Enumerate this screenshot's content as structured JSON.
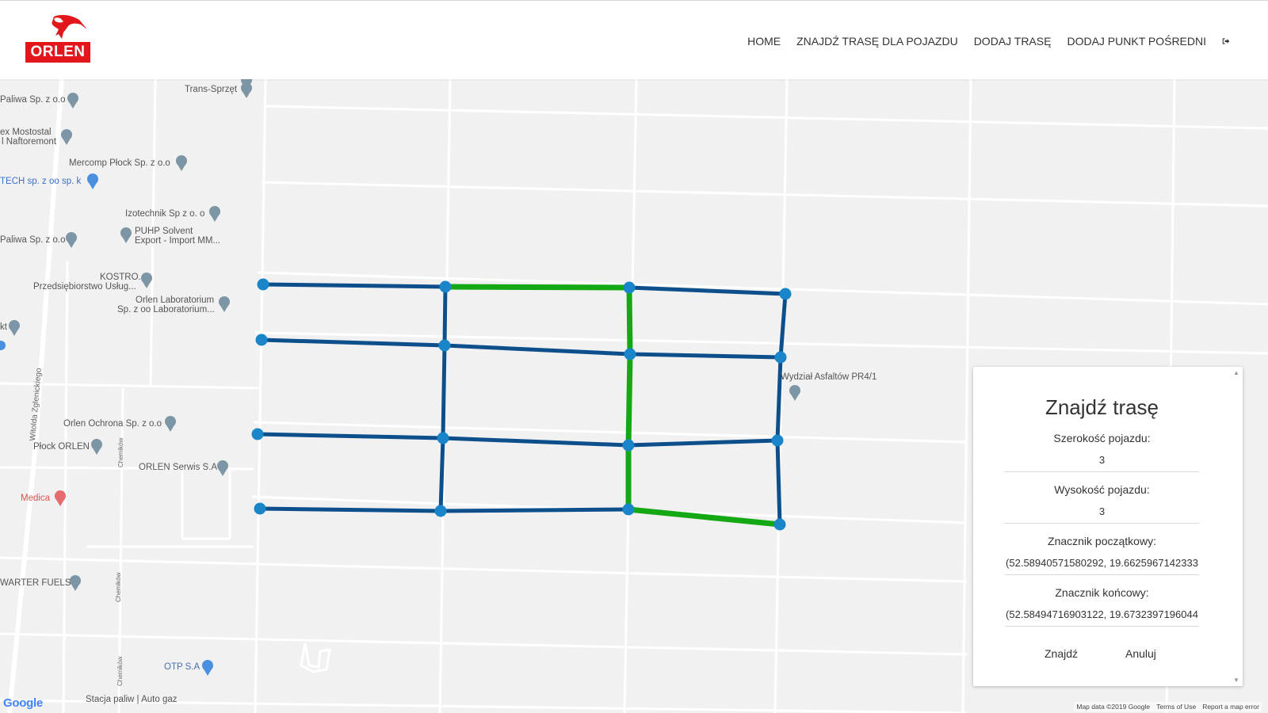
{
  "navbar": {
    "logo_text": "ORLEN",
    "items": [
      {
        "label": "HOME"
      },
      {
        "label": "ZNAJDŹ TRASĘ DLA POJAZDU"
      },
      {
        "label": "DODAJ TRASĘ"
      },
      {
        "label": "DODAJ PUNKT POŚREDNI"
      }
    ],
    "logout_icon": "sign-out-icon"
  },
  "map": {
    "pois": [
      {
        "label": "Trans-Sprzęt"
      },
      {
        "label": "Paliwa Sp. z o.o"
      },
      {
        "label": "ex Mostostal"
      },
      {
        "label": "l Naftoremont"
      },
      {
        "label": "Mercomp Płock Sp. z o.o"
      },
      {
        "label": "TECH sp. z oo sp. k"
      },
      {
        "label": "Izotechnik Sp z o. o"
      },
      {
        "label": "PUHP Solvent"
      },
      {
        "label": "Export - Import MM..."
      },
      {
        "label": "Paliwa Sp. z o.o"
      },
      {
        "label": "KOSTRO."
      },
      {
        "label": "Przedsiębiorstwo Usług..."
      },
      {
        "label": "Orlen Laboratorium"
      },
      {
        "label": "Sp. z oo Laboratorium..."
      },
      {
        "label": "kt"
      },
      {
        "label": "Orlen Ochrona Sp. z o.o"
      },
      {
        "label": "Płock ORLEN"
      },
      {
        "label": "ORLEN Serwis S.A"
      },
      {
        "label": "Medica"
      },
      {
        "label": "WARTER FUELS"
      },
      {
        "label": "OTP S.A"
      },
      {
        "label": "Wydział Asfaltów PR4/1"
      },
      {
        "label": "Stacja paliw | Auto gaz"
      }
    ],
    "streets": [
      {
        "label": "Witolda Zglenickiego"
      },
      {
        "label": "Chemików"
      },
      {
        "label": "Chemików"
      },
      {
        "label": "Chemików"
      }
    ],
    "google_logo": "Google",
    "footer": {
      "map_data": "Map data ©2019 Google",
      "terms": "Terms of Use",
      "report": "Report a map error"
    },
    "colors": {
      "route_blue": "#0d4f8b",
      "route_green": "#15a815",
      "node": "#1a85c9"
    }
  },
  "panel": {
    "title": "Znajdź trasę",
    "fields": [
      {
        "label": "Szerokość pojazdu:",
        "value": "3"
      },
      {
        "label": "Wysokość pojazdu:",
        "value": "3"
      },
      {
        "label": "Znacznik początkowy:",
        "value": "(52.58940571580292, 19.6625967142333"
      },
      {
        "label": "Znacznik końcowy:",
        "value": "(52.58494716903122, 19.6732397196044"
      }
    ],
    "find_button": "Znajdź",
    "cancel_button": "Anuluj"
  }
}
